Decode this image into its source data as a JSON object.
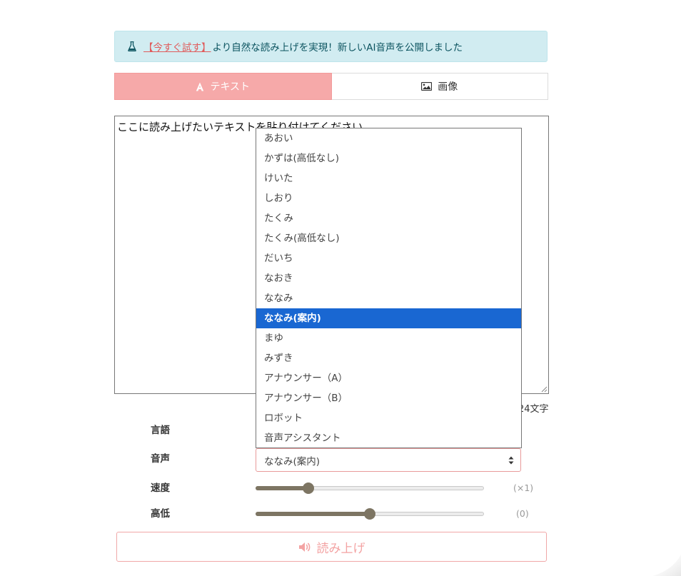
{
  "announcement": {
    "link_text": "【今すぐ試す】",
    "message": "より自然な読み上げを実現！新しいAI音声を公開しました",
    "icon": "flask-icon"
  },
  "tabs": [
    {
      "label": "テキスト",
      "icon": "font-icon",
      "active": true
    },
    {
      "label": "画像",
      "icon": "image-icon",
      "active": false
    }
  ],
  "textarea": {
    "text": "ここに読み上げたいテキストを貼り付けてください"
  },
  "char_count": "24文字",
  "settings": {
    "language_label": "言語",
    "voice_label": "音声",
    "speed_label": "速度",
    "pitch_label": "高低",
    "voice_selected": "ななみ(案内)",
    "speed_value_text": "(×1)",
    "speed_fraction": 0.23,
    "pitch_value_text": "(0)",
    "pitch_fraction": 0.5
  },
  "voice_options": [
    "あおい",
    "かずは(高低なし)",
    "けいた",
    "しおり",
    "たくみ",
    "たくみ(高低なし)",
    "だいち",
    "なおき",
    "ななみ",
    "ななみ(案内)",
    "まゆ",
    "みずき",
    "アナウンサー（A）",
    "アナウンサー（B）",
    "ロボット",
    "音声アシスタント"
  ],
  "voice_selected_index": 9,
  "read_button": {
    "label": "読み上げ",
    "icon": "speaker-icon"
  },
  "colors": {
    "accent": "#f6a9a9",
    "selection": "#1967d2",
    "alert_bg": "#d1ecf1",
    "slider": "#7d7563"
  }
}
